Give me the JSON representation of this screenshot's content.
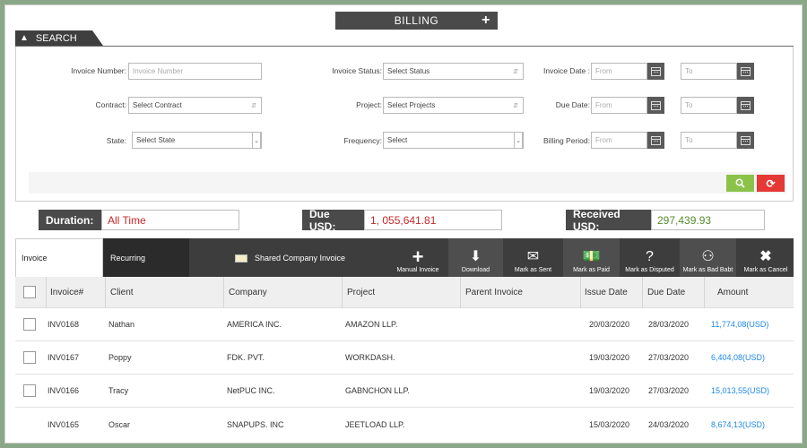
{
  "header": {
    "title": "BILLING",
    "add_icon": "plus-icon"
  },
  "search": {
    "tab_label": "SEARCH",
    "invoice_number_label": "Invoice Number:",
    "invoice_number_placeholder": "Invoice Number",
    "contract_label": "Contract:",
    "contract_value": "Select Contract",
    "state_label": "State:",
    "state_value": "Select State",
    "invoice_status_label": "Invoice Status:",
    "invoice_status_value": "Select Status",
    "project_label": "Project:",
    "project_value": "Select Projects",
    "frequency_label": "Frequency:",
    "frequency_value": "Select",
    "invoice_date_label": "Invoice Date :",
    "due_date_label": "Due Date:",
    "billing_period_label": "Billing Period:",
    "from_placeholder": "From",
    "to_placeholder": "To"
  },
  "summary": {
    "duration_label": "Duration:",
    "duration_value": "All Time",
    "due_label": "Due USD:",
    "due_value": "1, 055,641.81",
    "received_label": "Received USD:",
    "received_value": "297,439.93"
  },
  "tabs": {
    "invoice": "Invoice",
    "recurring": "Recurring",
    "shared": "Shared Company Invoice"
  },
  "toolbar": [
    {
      "label": "Manual Invoice",
      "icon": "plus-icon"
    },
    {
      "label": "Download",
      "icon": "download-icon"
    },
    {
      "label": "Mark as Sent",
      "icon": "envelope-icon"
    },
    {
      "label": "Mark as Paid",
      "icon": "money-icon"
    },
    {
      "label": "Mark as Disputed",
      "icon": "question-icon"
    },
    {
      "label": "Mark as Bad Babt",
      "icon": "person-icon"
    },
    {
      "label": "Mark as Cancel",
      "icon": "close-icon"
    }
  ],
  "table": {
    "columns": [
      "Invoice#",
      "Client",
      "Company",
      "Project",
      "Parent Invoice",
      "Issue Date",
      "Due Date",
      "Amount"
    ],
    "rows": [
      {
        "invoice": "INV0168",
        "client": "Nathan",
        "company": "AMERICA INC.",
        "project": "AMAZON LLP.",
        "parent": "",
        "issue": "20/03/2020",
        "due": "28/03/2020",
        "amount": "11,774,08(USD)"
      },
      {
        "invoice": "INV0167",
        "client": "Poppy",
        "company": "FDK. PVT.",
        "project": "WORKDASH.",
        "parent": "",
        "issue": "19/03/2020",
        "due": "27/03/2020",
        "amount": "6,404,08(USD)"
      },
      {
        "invoice": "INV0166",
        "client": "Tracy",
        "company": "NetPUC INC.",
        "project": "GABNCHON LLP.",
        "parent": "",
        "issue": "19/03/2020",
        "due": "27/03/2020",
        "amount": "15,013,55(USD)"
      },
      {
        "invoice": "INV0165",
        "client": "Oscar",
        "company": "SNAPUPS. INC",
        "project": "JEETLOAD LLP.",
        "parent": "",
        "issue": "15/03/2020",
        "due": "24/03/2020",
        "amount": "8,674,13(USD)"
      }
    ]
  },
  "colors": {
    "accent_dark": "#4a4a4a",
    "search_green": "#8bc34a",
    "refresh_red": "#e53935",
    "duration_red": "#c62828",
    "received_green": "#558b2f",
    "amount_blue": "#1e88e5"
  }
}
